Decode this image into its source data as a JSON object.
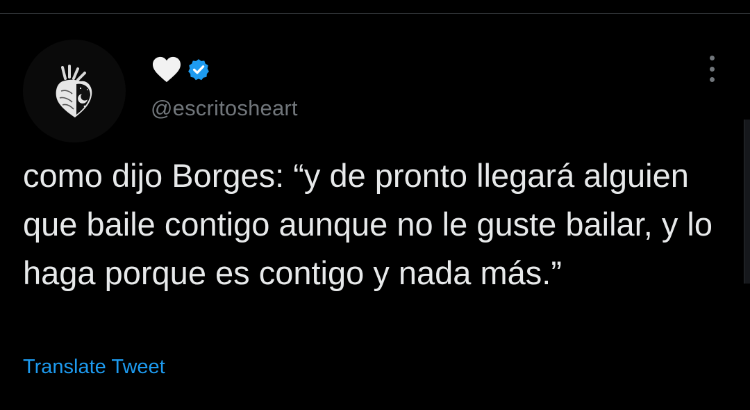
{
  "tweet": {
    "display_name_icon": "white-heart-icon",
    "verified_icon": "verified-badge-icon",
    "handle": "@escritosheart",
    "text": "como dijo Borges: “y de pronto llegará alguien que baile contigo aunque no le guste bailar, y lo haga porque es contigo y nada más.”",
    "translate_label": "Translate Tweet",
    "more_icon": "more-options-icon"
  },
  "colors": {
    "background": "#000000",
    "text": "#e7e9ea",
    "secondary": "#71767b",
    "accent": "#1d9bf0"
  }
}
